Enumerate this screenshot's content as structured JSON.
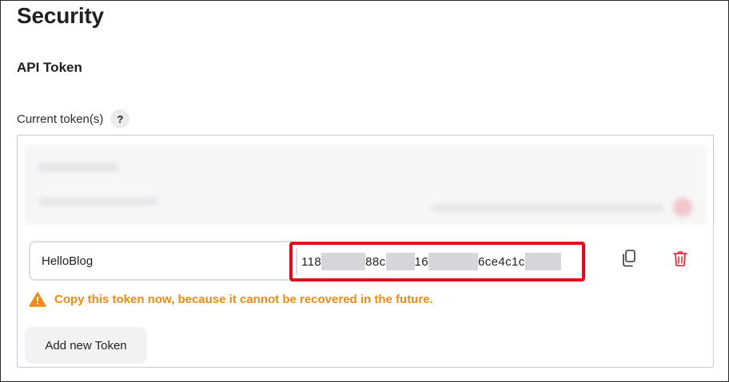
{
  "page": {
    "title": "Security"
  },
  "api_token": {
    "section_title": "API Token",
    "current_tokens_label": "Current token(s)",
    "help_symbol": "?",
    "token": {
      "name_value": "HelloBlog",
      "value_segments": [
        "118",
        "88c",
        "16",
        "6ce4c1c"
      ]
    },
    "warning_text": "Copy this token now, because it cannot be recovered in the future.",
    "add_button_label": "Add new Token",
    "icons": {
      "copy": "copy-icon",
      "delete": "trash-icon",
      "warning": "warning-triangle-icon"
    }
  },
  "colors": {
    "warning": "#ee8a18",
    "highlight_border": "#e20a1c",
    "delete": "#e0303f"
  }
}
